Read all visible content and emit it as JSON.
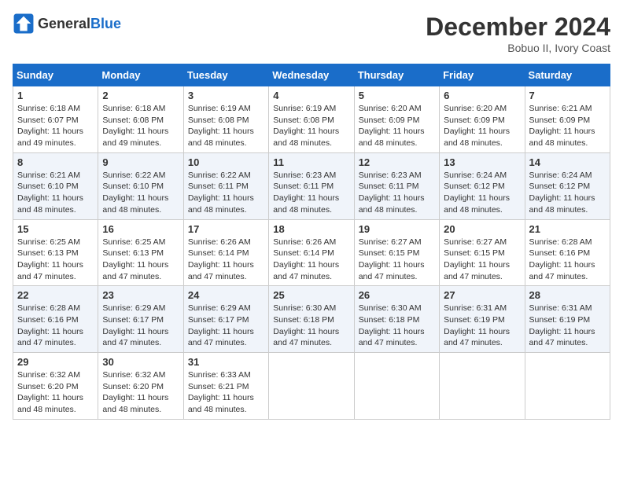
{
  "header": {
    "logo_general": "General",
    "logo_blue": "Blue",
    "month_title": "December 2024",
    "location": "Bobuo II, Ivory Coast"
  },
  "days_of_week": [
    "Sunday",
    "Monday",
    "Tuesday",
    "Wednesday",
    "Thursday",
    "Friday",
    "Saturday"
  ],
  "weeks": [
    [
      {
        "day": "1",
        "sunrise": "6:18 AM",
        "sunset": "6:07 PM",
        "daylight": "11 hours and 49 minutes."
      },
      {
        "day": "2",
        "sunrise": "6:18 AM",
        "sunset": "6:08 PM",
        "daylight": "11 hours and 49 minutes."
      },
      {
        "day": "3",
        "sunrise": "6:19 AM",
        "sunset": "6:08 PM",
        "daylight": "11 hours and 48 minutes."
      },
      {
        "day": "4",
        "sunrise": "6:19 AM",
        "sunset": "6:08 PM",
        "daylight": "11 hours and 48 minutes."
      },
      {
        "day": "5",
        "sunrise": "6:20 AM",
        "sunset": "6:09 PM",
        "daylight": "11 hours and 48 minutes."
      },
      {
        "day": "6",
        "sunrise": "6:20 AM",
        "sunset": "6:09 PM",
        "daylight": "11 hours and 48 minutes."
      },
      {
        "day": "7",
        "sunrise": "6:21 AM",
        "sunset": "6:09 PM",
        "daylight": "11 hours and 48 minutes."
      }
    ],
    [
      {
        "day": "8",
        "sunrise": "6:21 AM",
        "sunset": "6:10 PM",
        "daylight": "11 hours and 48 minutes."
      },
      {
        "day": "9",
        "sunrise": "6:22 AM",
        "sunset": "6:10 PM",
        "daylight": "11 hours and 48 minutes."
      },
      {
        "day": "10",
        "sunrise": "6:22 AM",
        "sunset": "6:11 PM",
        "daylight": "11 hours and 48 minutes."
      },
      {
        "day": "11",
        "sunrise": "6:23 AM",
        "sunset": "6:11 PM",
        "daylight": "11 hours and 48 minutes."
      },
      {
        "day": "12",
        "sunrise": "6:23 AM",
        "sunset": "6:11 PM",
        "daylight": "11 hours and 48 minutes."
      },
      {
        "day": "13",
        "sunrise": "6:24 AM",
        "sunset": "6:12 PM",
        "daylight": "11 hours and 48 minutes."
      },
      {
        "day": "14",
        "sunrise": "6:24 AM",
        "sunset": "6:12 PM",
        "daylight": "11 hours and 48 minutes."
      }
    ],
    [
      {
        "day": "15",
        "sunrise": "6:25 AM",
        "sunset": "6:13 PM",
        "daylight": "11 hours and 47 minutes."
      },
      {
        "day": "16",
        "sunrise": "6:25 AM",
        "sunset": "6:13 PM",
        "daylight": "11 hours and 47 minutes."
      },
      {
        "day": "17",
        "sunrise": "6:26 AM",
        "sunset": "6:14 PM",
        "daylight": "11 hours and 47 minutes."
      },
      {
        "day": "18",
        "sunrise": "6:26 AM",
        "sunset": "6:14 PM",
        "daylight": "11 hours and 47 minutes."
      },
      {
        "day": "19",
        "sunrise": "6:27 AM",
        "sunset": "6:15 PM",
        "daylight": "11 hours and 47 minutes."
      },
      {
        "day": "20",
        "sunrise": "6:27 AM",
        "sunset": "6:15 PM",
        "daylight": "11 hours and 47 minutes."
      },
      {
        "day": "21",
        "sunrise": "6:28 AM",
        "sunset": "6:16 PM",
        "daylight": "11 hours and 47 minutes."
      }
    ],
    [
      {
        "day": "22",
        "sunrise": "6:28 AM",
        "sunset": "6:16 PM",
        "daylight": "11 hours and 47 minutes."
      },
      {
        "day": "23",
        "sunrise": "6:29 AM",
        "sunset": "6:17 PM",
        "daylight": "11 hours and 47 minutes."
      },
      {
        "day": "24",
        "sunrise": "6:29 AM",
        "sunset": "6:17 PM",
        "daylight": "11 hours and 47 minutes."
      },
      {
        "day": "25",
        "sunrise": "6:30 AM",
        "sunset": "6:18 PM",
        "daylight": "11 hours and 47 minutes."
      },
      {
        "day": "26",
        "sunrise": "6:30 AM",
        "sunset": "6:18 PM",
        "daylight": "11 hours and 47 minutes."
      },
      {
        "day": "27",
        "sunrise": "6:31 AM",
        "sunset": "6:19 PM",
        "daylight": "11 hours and 47 minutes."
      },
      {
        "day": "28",
        "sunrise": "6:31 AM",
        "sunset": "6:19 PM",
        "daylight": "11 hours and 47 minutes."
      }
    ],
    [
      {
        "day": "29",
        "sunrise": "6:32 AM",
        "sunset": "6:20 PM",
        "daylight": "11 hours and 48 minutes."
      },
      {
        "day": "30",
        "sunrise": "6:32 AM",
        "sunset": "6:20 PM",
        "daylight": "11 hours and 48 minutes."
      },
      {
        "day": "31",
        "sunrise": "6:33 AM",
        "sunset": "6:21 PM",
        "daylight": "11 hours and 48 minutes."
      },
      null,
      null,
      null,
      null
    ]
  ]
}
